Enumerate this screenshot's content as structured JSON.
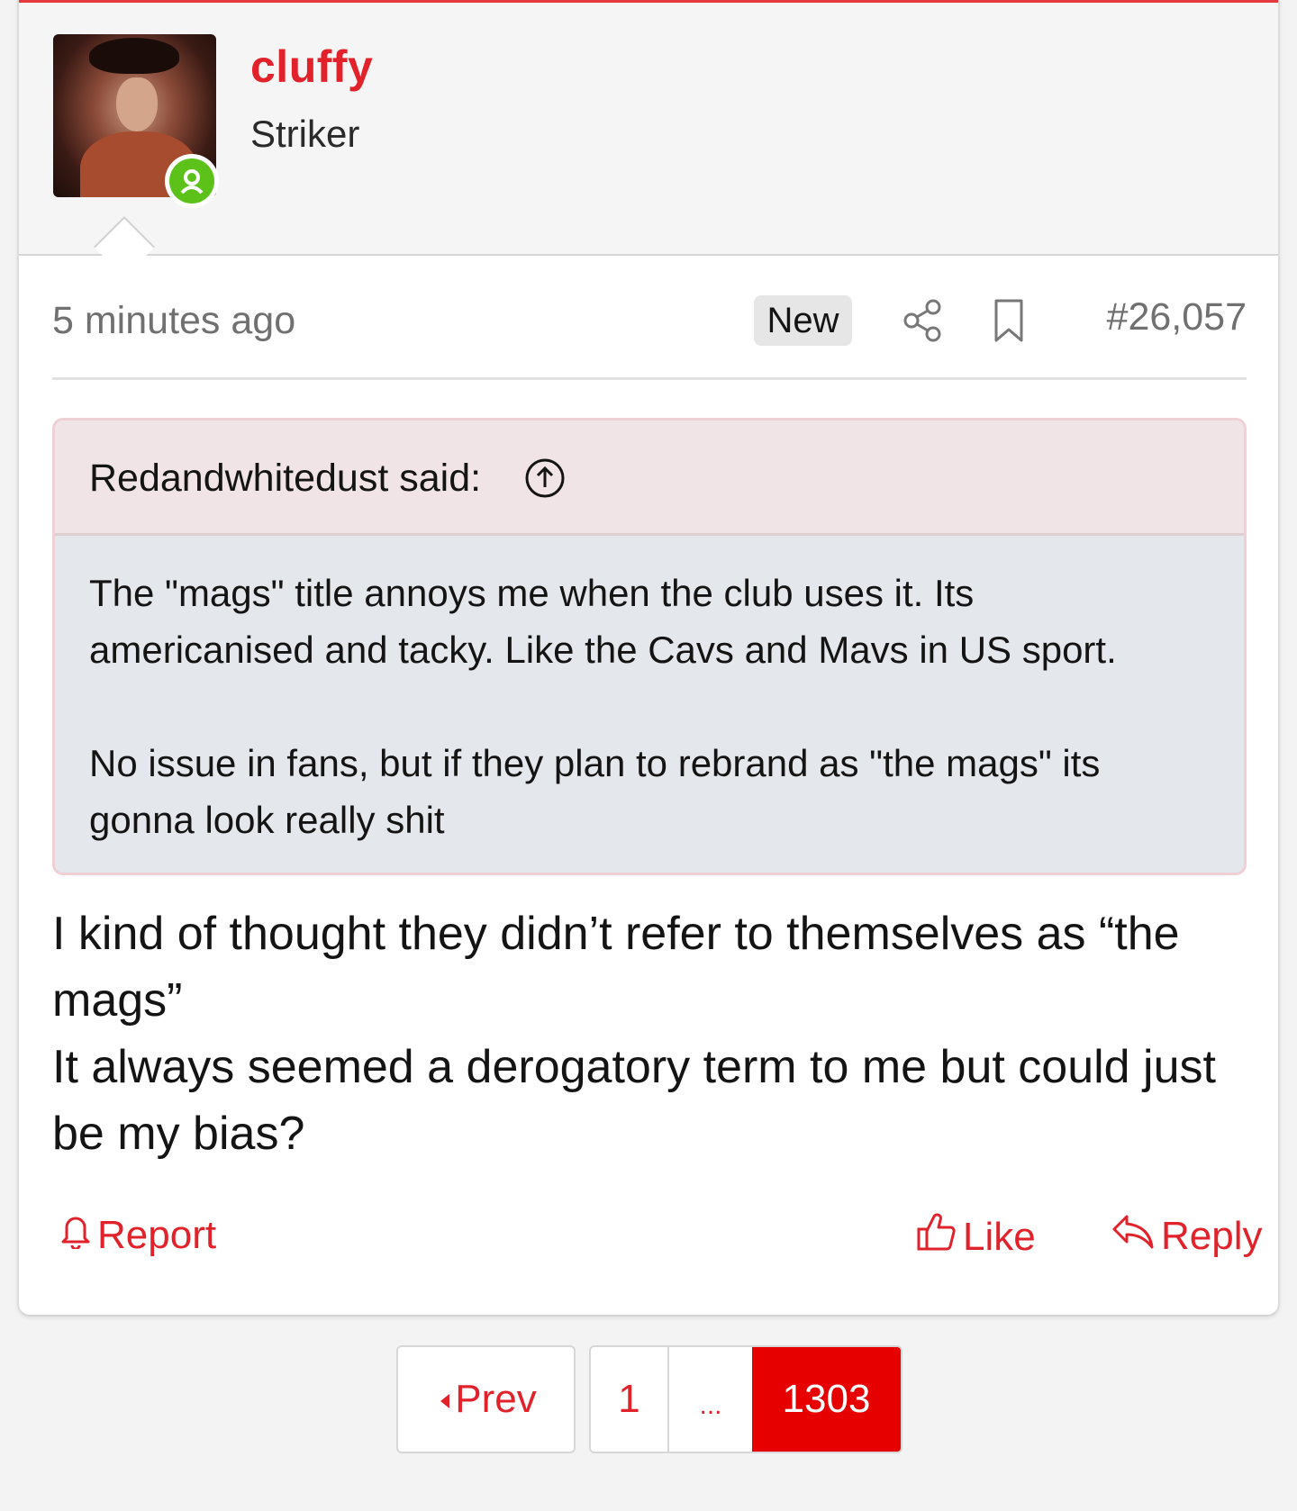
{
  "post": {
    "author": {
      "name": "cluffy",
      "title": "Striker",
      "online": true,
      "avatar_icon": "user-avatar-photo"
    },
    "meta": {
      "time": "5 minutes ago",
      "badge": "New",
      "post_number": "#26,057"
    },
    "quote": {
      "author_line": "Redandwhitedust said:",
      "paragraphs": [
        "The \"mags\" title annoys me when the club uses it. Its americanised and tacky. Like the Cavs and Mavs in US sport.",
        "No issue in fans, but if they plan to rebrand as \"the mags\" its gonna look really shit"
      ]
    },
    "message": {
      "lines": [
        "I kind of thought they didn’t refer to themselves as “the mags”",
        "It always seemed a derogatory term to me but could just be my bias?"
      ]
    },
    "actions": {
      "report": "Report",
      "like": "Like",
      "reply": "Reply"
    }
  },
  "pagination": {
    "prev": "Prev",
    "first": "1",
    "ellipsis": "...",
    "current": "1303"
  },
  "colors": {
    "accent": "#e2222a",
    "current_page_bg": "#e60000",
    "online": "#5cc21a",
    "quote_head_bg": "#f1e4e6",
    "quote_body_bg": "#e4e7eb"
  }
}
